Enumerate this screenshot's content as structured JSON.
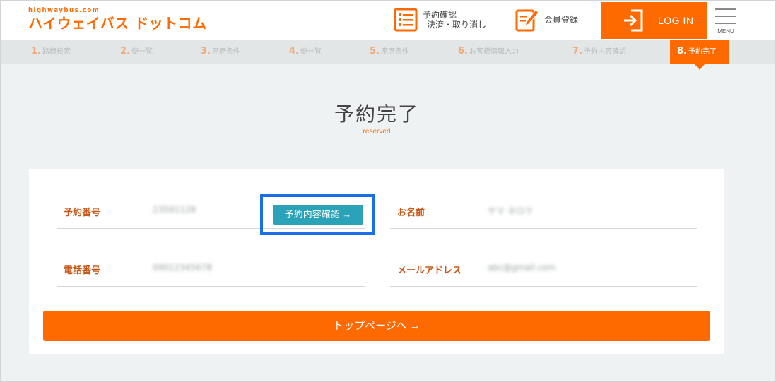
{
  "header": {
    "logo_small": "highwaybus.com",
    "logo_main": "ハイウェイバス ドットコム",
    "reserve_line1": "予約確認",
    "reserve_line2": "決済・取り消し",
    "member_label": "会員登録",
    "login_label": "LOG IN",
    "menu_label": "MENU"
  },
  "steps": [
    {
      "num": "1.",
      "label": "路線検索"
    },
    {
      "num": "2.",
      "label": "便一覧"
    },
    {
      "num": "3.",
      "label": "座席条件"
    },
    {
      "num": "4.",
      "label": "便一覧"
    },
    {
      "num": "5.",
      "label": "座席条件"
    },
    {
      "num": "6.",
      "label": "お客様情報入力"
    },
    {
      "num": "7.",
      "label": "予約内容確認"
    },
    {
      "num": "8.",
      "label": "予約完了"
    }
  ],
  "page": {
    "title": "予約完了",
    "subtitle": "reserved"
  },
  "fields": {
    "reservation_number_label": "予約番号",
    "reservation_number_value": "23591128",
    "confirm_button": "予約内容確認 →",
    "name_label": "お名前",
    "name_value": "ヤマ  タロウ",
    "phone_label": "電話番号",
    "phone_value": "09012345678",
    "email_label": "メールアドレス",
    "email_value": "abc@gmail.com"
  },
  "top_button": "トップページへ →",
  "colors": {
    "brand_orange": "#ff6a00",
    "label_orange": "#c55a1a",
    "teal_button": "#2aa3b8",
    "highlight_blue": "#1a6fe8"
  }
}
